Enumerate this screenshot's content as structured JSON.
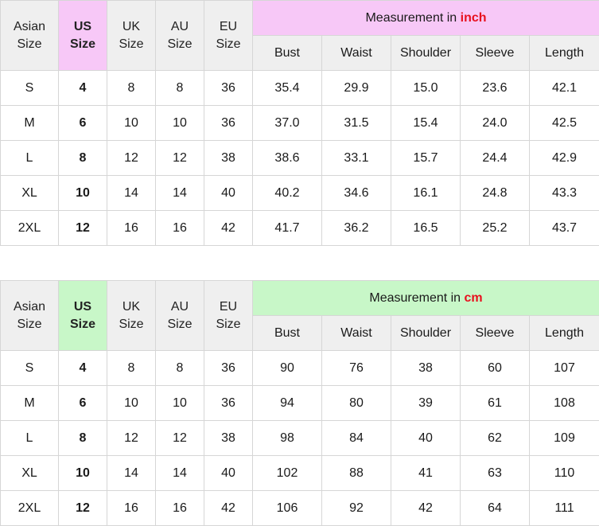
{
  "tables": [
    {
      "header": {
        "asian_l1": "Asian",
        "asian_l2": "Size",
        "us_l1": "US",
        "us_l2": "Size",
        "uk_l1": "UK",
        "uk_l2": "Size",
        "au_l1": "AU",
        "au_l2": "Size",
        "eu_l1": "EU",
        "eu_l2": "Size",
        "measurement_prefix": "Measurement in ",
        "measurement_unit": "inch",
        "columns": [
          "Bust",
          "Waist",
          "Shoulder",
          "Sleeve",
          "Length"
        ]
      },
      "rows": [
        [
          "S",
          "4",
          "8",
          "8",
          "36",
          "35.4",
          "29.9",
          "15.0",
          "23.6",
          "42.1"
        ],
        [
          "M",
          "6",
          "10",
          "10",
          "36",
          "37.0",
          "31.5",
          "15.4",
          "24.0",
          "42.5"
        ],
        [
          "L",
          "8",
          "12",
          "12",
          "38",
          "38.6",
          "33.1",
          "15.7",
          "24.4",
          "42.9"
        ],
        [
          "XL",
          "10",
          "14",
          "14",
          "40",
          "40.2",
          "34.6",
          "16.1",
          "24.8",
          "43.3"
        ],
        [
          "2XL",
          "12",
          "16",
          "16",
          "42",
          "41.7",
          "36.2",
          "16.5",
          "25.2",
          "43.7"
        ]
      ],
      "accent_color": "#f7c8f7"
    },
    {
      "header": {
        "asian_l1": "Asian",
        "asian_l2": "Size",
        "us_l1": "US",
        "us_l2": "Size",
        "uk_l1": "UK",
        "uk_l2": "Size",
        "au_l1": "AU",
        "au_l2": "Size",
        "eu_l1": "EU",
        "eu_l2": "Size",
        "measurement_prefix": "Measurement in ",
        "measurement_unit": "cm",
        "columns": [
          "Bust",
          "Waist",
          "Shoulder",
          "Sleeve",
          "Length"
        ]
      },
      "rows": [
        [
          "S",
          "4",
          "8",
          "8",
          "36",
          "90",
          "76",
          "38",
          "60",
          "107"
        ],
        [
          "M",
          "6",
          "10",
          "10",
          "36",
          "94",
          "80",
          "39",
          "61",
          "108"
        ],
        [
          "L",
          "8",
          "12",
          "12",
          "38",
          "98",
          "84",
          "40",
          "62",
          "109"
        ],
        [
          "XL",
          "10",
          "14",
          "14",
          "40",
          "102",
          "88",
          "41",
          "63",
          "110"
        ],
        [
          "2XL",
          "12",
          "16",
          "16",
          "42",
          "106",
          "92",
          "42",
          "64",
          "111"
        ]
      ],
      "accent_color": "#c8f7c8"
    }
  ],
  "unit_color": "#e8101e"
}
